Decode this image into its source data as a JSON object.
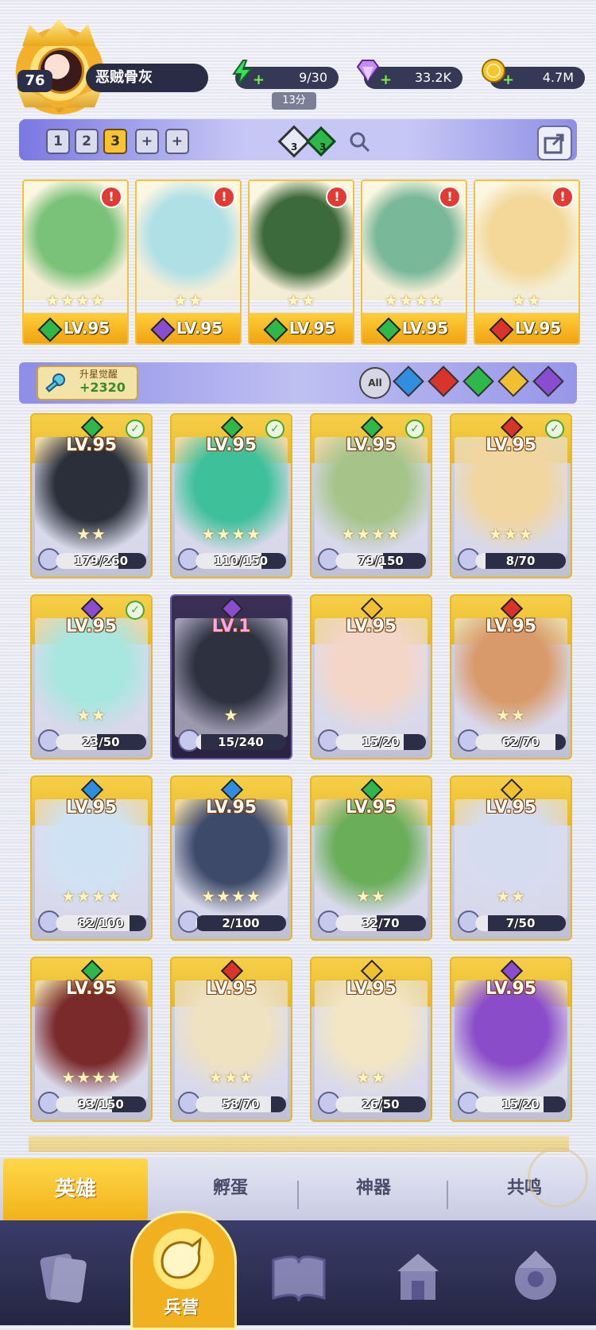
{
  "player": {
    "level": "76",
    "name": "恶贼骨灰"
  },
  "resources": {
    "energy": "9/30",
    "energy_timer": "13分",
    "gems": "33.2K",
    "gold": "4.7M"
  },
  "team_tabs": [
    "1",
    "2",
    "3",
    "+",
    "+"
  ],
  "team_active_index": 2,
  "team_info": {
    "element_count_a": "3",
    "element_count_b": "3"
  },
  "featured": [
    {
      "level": "LV.95",
      "stars": "★★★★",
      "element": "green",
      "element_color": "#2eb84a",
      "art": "#7ac27a"
    },
    {
      "level": "LV.95",
      "stars": "★★",
      "element": "purple",
      "element_color": "#8a4cd0",
      "art": "#aee0e6"
    },
    {
      "level": "LV.95",
      "stars": "★★",
      "element": "green",
      "element_color": "#2eb84a",
      "art": "#3c6a3c"
    },
    {
      "level": "LV.95",
      "stars": "★★★★",
      "element": "green",
      "element_color": "#2eb84a",
      "art": "#7ab89a"
    },
    {
      "level": "LV.95",
      "stars": "★★",
      "element": "red",
      "element_color": "#d8342a",
      "art": "#f3d89a"
    }
  ],
  "awaken": {
    "title": "升星觉醒",
    "value": "+2320"
  },
  "filter": {
    "all_label": "All",
    "elements": [
      {
        "name": "water",
        "color": "#2e8fe0"
      },
      {
        "name": "fire",
        "color": "#d8342a"
      },
      {
        "name": "nature",
        "color": "#2eb84a"
      },
      {
        "name": "light",
        "color": "#f0c030"
      },
      {
        "name": "dark",
        "color": "#8a4cd0"
      }
    ]
  },
  "heroes": [
    {
      "level": "LV.95",
      "progress": "179/260",
      "ratio": 0.69,
      "stars": "★★",
      "element_color": "#2eb84a",
      "art": "#2a2f3a",
      "checked": true
    },
    {
      "level": "LV.95",
      "progress": "110/150",
      "ratio": 0.73,
      "stars": "★★★★",
      "element_color": "#2eb84a",
      "art": "#3ec09a",
      "checked": true
    },
    {
      "level": "LV.95",
      "progress": "79/150",
      "ratio": 0.53,
      "stars": "★★★★",
      "element_color": "#2eb84a",
      "art": "#a6c48a",
      "checked": true
    },
    {
      "level": "LV.95",
      "progress": "8/70",
      "ratio": 0.11,
      "stars": "★★★",
      "element_color": "#d8342a",
      "art": "#f2d6a0",
      "checked": true
    },
    {
      "level": "LV.95",
      "progress": "23/50",
      "ratio": 0.46,
      "stars": "★★",
      "element_color": "#8a4cd0",
      "art": "#a8e6e0",
      "checked": true
    },
    {
      "level": "LV.1",
      "progress": "15/240",
      "ratio": 0.06,
      "stars": "★",
      "element_color": "#8a4cd0",
      "art": "#2e3240",
      "checked": false
    },
    {
      "level": "LV.95",
      "progress": "15/20",
      "ratio": 0.75,
      "stars": "",
      "element_color": "#f0c030",
      "art": "#f4d6c8",
      "checked": false
    },
    {
      "level": "LV.95",
      "progress": "62/70",
      "ratio": 0.89,
      "stars": "★★",
      "element_color": "#d8342a",
      "art": "#d89a6a",
      "checked": false
    },
    {
      "level": "LV.95",
      "progress": "82/100",
      "ratio": 0.82,
      "stars": "★★★★",
      "element_color": "#2e8fe0",
      "art": "#cfe2f4",
      "checked": false
    },
    {
      "level": "LV.95",
      "progress": "2/100",
      "ratio": 0.02,
      "stars": "★★★★",
      "element_color": "#2e8fe0",
      "art": "#3e4a6a",
      "checked": false
    },
    {
      "level": "LV.95",
      "progress": "32/70",
      "ratio": 0.46,
      "stars": "★★",
      "element_color": "#2eb84a",
      "art": "#6aae5a",
      "checked": false
    },
    {
      "level": "LV.95",
      "progress": "7/50",
      "ratio": 0.14,
      "stars": "★★",
      "element_color": "#f0c030",
      "art": "#d6dcf0",
      "checked": false
    },
    {
      "level": "LV.95",
      "progress": "93/150",
      "ratio": 0.62,
      "stars": "★★★★",
      "element_color": "#2eb84a",
      "art": "#7a2a2a",
      "checked": false
    },
    {
      "level": "LV.95",
      "progress": "58/70",
      "ratio": 0.83,
      "stars": "★★★",
      "element_color": "#d8342a",
      "art": "#efe2c0",
      "checked": false
    },
    {
      "level": "LV.95",
      "progress": "26/50",
      "ratio": 0.52,
      "stars": "★★",
      "element_color": "#f0c030",
      "art": "#f2e6c4",
      "checked": false
    },
    {
      "level": "LV.95",
      "progress": "15/20",
      "ratio": 0.75,
      "stars": "",
      "element_color": "#8a4cd0",
      "art": "#8a4cc8",
      "checked": false
    }
  ],
  "subtabs": [
    "英雄",
    "孵蛋",
    "神器",
    "共鸣"
  ],
  "subtab_active_index": 0,
  "nav": {
    "center_label": "兵营"
  }
}
